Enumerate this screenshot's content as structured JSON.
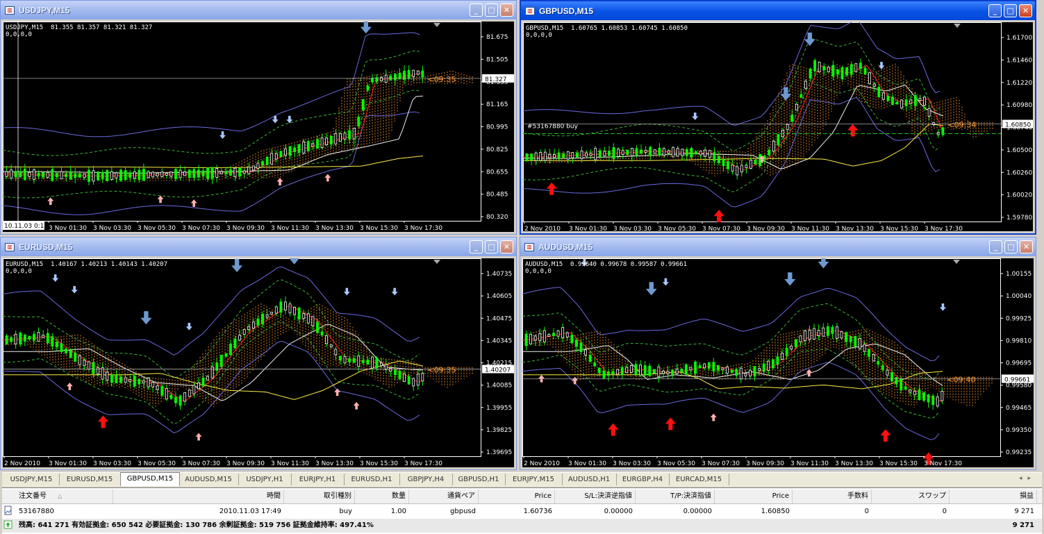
{
  "windows": [
    {
      "title": "USDJPY,M15",
      "header": "USDJPY,M15  81.355 81.357 81.321 81.327",
      "sub": "0,0,0,0",
      "active": false,
      "prices": [
        "81.675",
        "81.505",
        "81.335",
        "81.165",
        "80.995",
        "80.825",
        "80.655",
        "80.485",
        "80.320"
      ],
      "current": "81.327",
      "timer": "<09:35",
      "crosshair": "10.11.03 0:15",
      "times": [
        "3 Nov 01:30",
        "3 Nov 03:30",
        "3 Nov 05:30",
        "3 Nov 07:30",
        "3 Nov 09:30",
        "3 Nov 11:30",
        "3 Nov 13:30",
        "3 Nov 15:30",
        "3 Nov 17:30"
      ]
    },
    {
      "title": "GBPUSD,M15",
      "header": "GBPUSD,M15  1.60765 1.60853 1.60745 1.60850",
      "sub": "0,0,0,0",
      "active": true,
      "prices": [
        "1.61700",
        "1.61460",
        "1.61220",
        "1.60980",
        "1.60740",
        "1.60500",
        "1.60260",
        "1.60020",
        "1.59780"
      ],
      "current": "1.60850",
      "timer": "<09:34",
      "order": "#53167880 buy",
      "times": [
        "2 Nov 2010",
        "3 Nov 01:30",
        "3 Nov 03:30",
        "3 Nov 05:30",
        "3 Nov 07:30",
        "3 Nov 09:30",
        "3 Nov 11:30",
        "3 Nov 13:30",
        "3 Nov 15:30",
        "3 Nov 17:30"
      ]
    },
    {
      "title": "EURUSD,M15",
      "header": "EURUSD,M15  1.40167 1.40213 1.40143 1.40207",
      "sub": "0,0,0,0",
      "active": false,
      "prices": [
        "1.40735",
        "1.40605",
        "1.40475",
        "1.40345",
        "1.40215",
        "1.40085",
        "1.39955",
        "1.39825",
        "1.39695"
      ],
      "current": "1.40207",
      "timer": "<09:35",
      "times": [
        "2 Nov 2010",
        "3 Nov 01:30",
        "3 Nov 03:30",
        "3 Nov 05:30",
        "3 Nov 07:30",
        "3 Nov 09:30",
        "3 Nov 11:30",
        "3 Nov 13:30",
        "3 Nov 15:30",
        "3 Nov 17:30"
      ]
    },
    {
      "title": "AUDUSD,M15",
      "header": "AUDUSD,M15  0.99640 0.99678 0.99587 0.99661",
      "sub": "0,0,0,0",
      "active": false,
      "prices": [
        "1.00155",
        "1.00040",
        "0.99925",
        "0.99810",
        "0.99695",
        "0.99580",
        "0.99465",
        "0.99350",
        "0.99235"
      ],
      "current": "0.99661",
      "timer": "<09:40",
      "times": [
        "2 Nov 2010",
        "3 Nov 01:30",
        "3 Nov 03:30",
        "3 Nov 05:30",
        "3 Nov 07:30",
        "3 Nov 09:30",
        "3 Nov 11:30",
        "3 Nov 13:30",
        "3 Nov 15:30",
        "3 Nov 17:30"
      ]
    }
  ],
  "tabs": [
    "USDJPY,M15",
    "EURUSD,M15",
    "GBPUSD,M15",
    "AUDUSD,M15",
    "USDJPY,H1",
    "EURJPY,H1",
    "EURUSD,H1",
    "GBPJPY,H4",
    "GBPUSD,H1",
    "EURJPY,M15",
    "AUDUSD,H1",
    "EURGBP,H4",
    "EURCAD,M15"
  ],
  "selected_tab": "GBPUSD,M15",
  "terminal": {
    "columns": [
      "注文番号",
      "時間",
      "取引種別",
      "数量",
      "通貨ペア",
      "Price",
      "S/L:決済逆指値",
      "T/P:決済指値",
      "Price",
      "手数料",
      "スワップ",
      "損益"
    ],
    "row": [
      "53167880",
      "2010.11.03 17:49",
      "buy",
      "1.00",
      "gbpusd",
      "1.60736",
      "0.00000",
      "0.00000",
      "1.60850",
      "0",
      "0",
      "9 271"
    ],
    "footer": "残高: 641 271  有効証拠金: 650 542  必要証拠金: 130 786  余剰証拠金: 519 756  証拠金維持率: 497.41%",
    "footer_total": "9 271"
  },
  "colors": {
    "bull": "#00ff00",
    "bear": "#ffffff",
    "band": "#6a6adf",
    "midband": "#3bb33b",
    "ma_red": "#ff2020",
    "ma_white": "#f0f0f0",
    "ma_yellow": "#ffee44",
    "cloud": "#ff9933",
    "up_arrow": "#ffb0b0",
    "big_up": "#ff1010",
    "down_arrow": "#a8c8ff",
    "big_down": "#6e9ad0"
  }
}
